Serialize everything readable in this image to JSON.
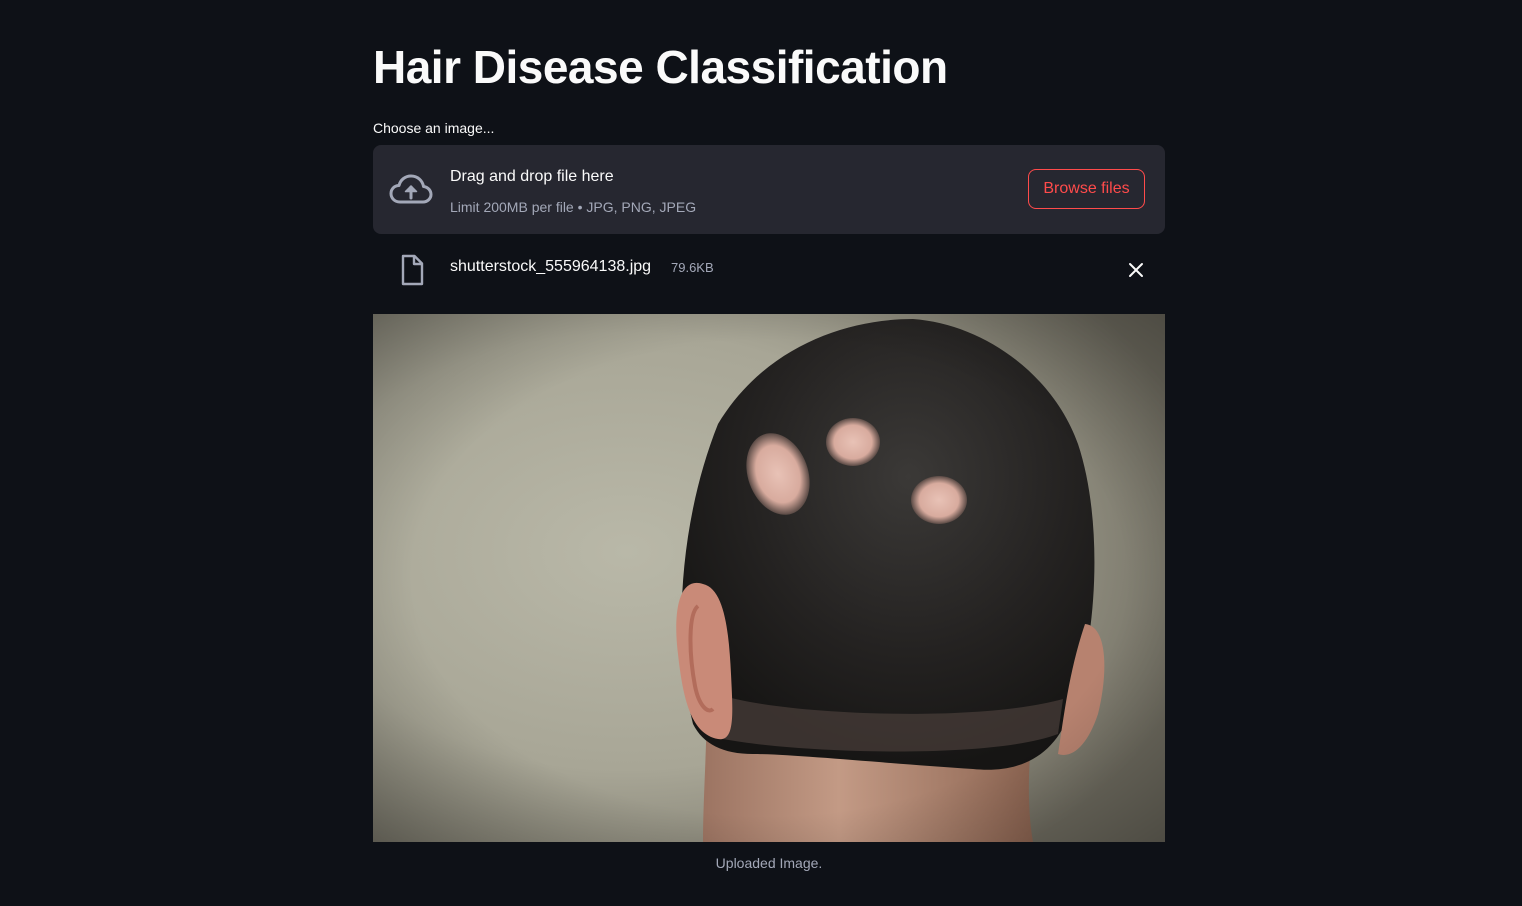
{
  "page": {
    "title": "Hair Disease Classification"
  },
  "uploader": {
    "label": "Choose an image...",
    "drop_title": "Drag and drop file here",
    "drop_hint": "Limit 200MB per file • JPG, PNG, JPEG",
    "browse_label": "Browse files",
    "icon": "cloud-upload-icon"
  },
  "uploaded_file": {
    "name": "shutterstock_555964138.jpg",
    "size": "79.6KB",
    "icon": "file-icon",
    "remove_icon": "close-icon"
  },
  "preview": {
    "caption": "Uploaded Image."
  },
  "colors": {
    "background": "#0e1117",
    "panel": "#262730",
    "accent": "#ff4b4b",
    "text": "#fafafa",
    "muted": "#a3a8b8"
  }
}
